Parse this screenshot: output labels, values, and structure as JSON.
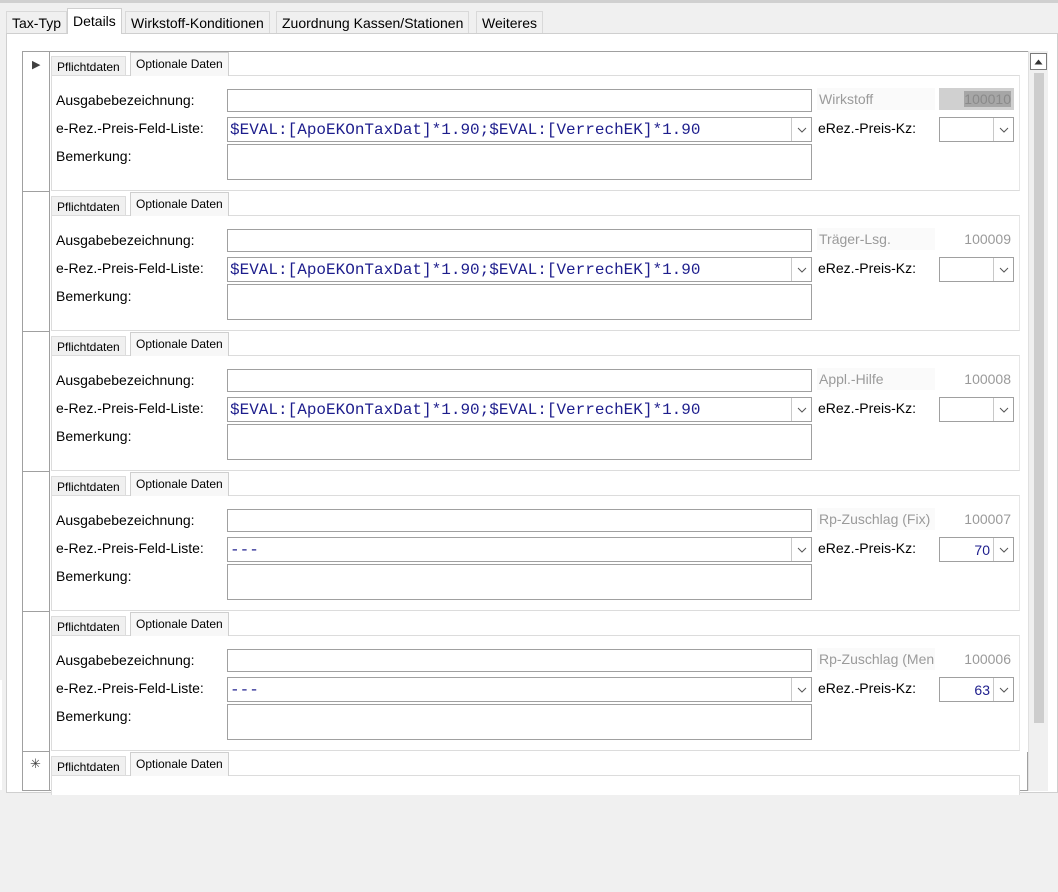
{
  "tabs": [
    {
      "label": "Tax-Typ",
      "active": false
    },
    {
      "label": "Details",
      "active": true
    },
    {
      "label": "Wirkstoff-Konditionen",
      "active": false
    },
    {
      "label": "Zuordnung Kassen/Stationen",
      "active": false
    },
    {
      "label": "Weiteres",
      "active": false
    }
  ],
  "subtabs": {
    "pflicht": "Pflichtdaten",
    "optional": "Optionale Daten"
  },
  "labels": {
    "ausgabe": "Ausgabebezeichnung:",
    "liste": "e-Rez.-Preis-Feld-Liste:",
    "bemerkung": "Bemerkung:",
    "kz": "eRez.-Preis-Kz:"
  },
  "records": [
    {
      "name": "Wirkstoff",
      "id": "100010",
      "ausgabe": "",
      "liste": "$EVAL:[ApoEKOnTaxDat]*1.90;$EVAL:[VerrechEK]*1.90",
      "kz": "",
      "bemerkung": "",
      "selected": true
    },
    {
      "name": "Träger-Lsg.",
      "id": "100009",
      "ausgabe": "",
      "liste": "$EVAL:[ApoEKOnTaxDat]*1.90;$EVAL:[VerrechEK]*1.90",
      "kz": "",
      "bemerkung": "",
      "selected": false
    },
    {
      "name": "Appl.-Hilfe",
      "id": "100008",
      "ausgabe": "",
      "liste": "$EVAL:[ApoEKOnTaxDat]*1.90;$EVAL:[VerrechEK]*1.90",
      "kz": "",
      "bemerkung": "",
      "selected": false
    },
    {
      "name": "Rp-Zuschlag (Fix)",
      "id": "100007",
      "ausgabe": "",
      "liste": "---",
      "kz": "70",
      "bemerkung": "",
      "selected": false
    },
    {
      "name": "Rp-Zuschlag (Men",
      "id": "100006",
      "ausgabe": "",
      "liste": "---",
      "kz": "63",
      "bemerkung": "",
      "selected": false
    }
  ],
  "selector": {
    "current": "▶",
    "new": "✳"
  }
}
